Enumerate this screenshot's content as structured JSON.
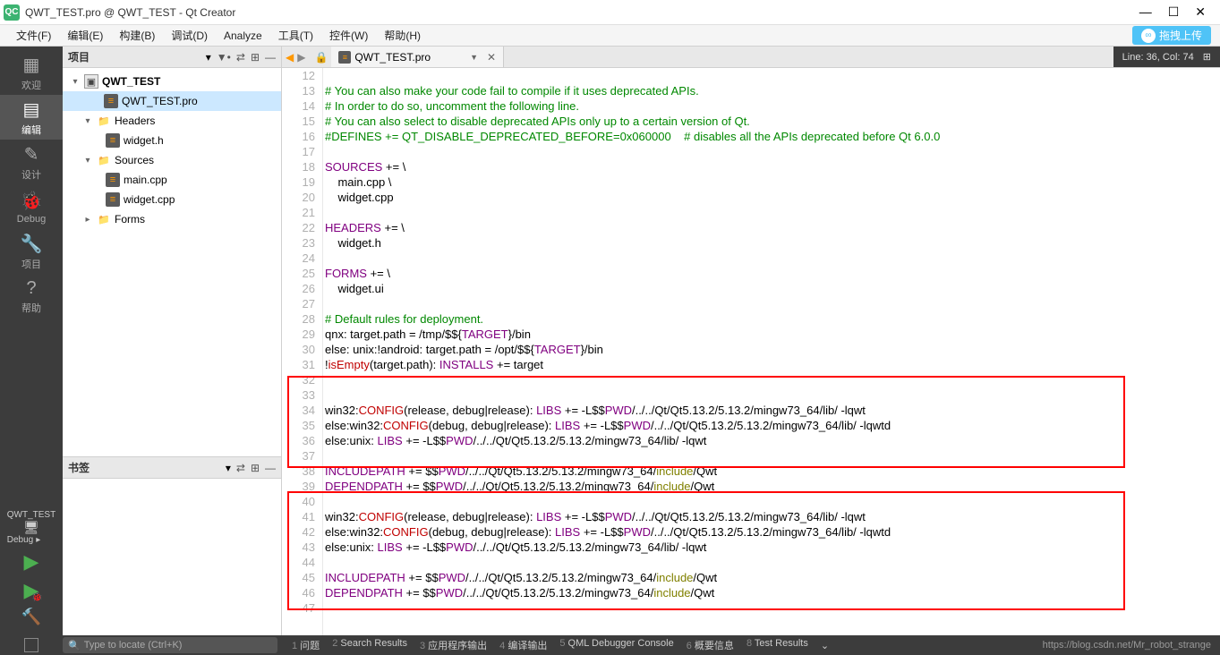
{
  "window": {
    "title": "QWT_TEST.pro @ QWT_TEST - Qt Creator"
  },
  "menu": {
    "file": "文件(F)",
    "edit": "编辑(E)",
    "build": "构建(B)",
    "debug": "调试(D)",
    "analyze": "Analyze",
    "tools": "工具(T)",
    "widgets": "控件(W)",
    "help": "帮助(H)",
    "cloud_upload": "拖拽上传"
  },
  "left_nav": {
    "welcome": "欢迎",
    "edit": "编辑",
    "design": "设计",
    "debug": "Debug",
    "projects": "项目",
    "help": "帮助",
    "kit_name": "QWT_TEST",
    "debug_sel": "Debug"
  },
  "panel": {
    "project_title": "项目",
    "bookmarks_title": "书签"
  },
  "tree": {
    "root": "QWT_TEST",
    "pro_file": "QWT_TEST.pro",
    "headers": "Headers",
    "widget_h": "widget.h",
    "sources": "Sources",
    "main_cpp": "main.cpp",
    "widget_cpp": "widget.cpp",
    "forms": "Forms"
  },
  "tab": {
    "filename": "QWT_TEST.pro"
  },
  "status": {
    "cursor": "Line: 36, Col: 74"
  },
  "code": {
    "lines": [
      {
        "n": 12,
        "t": ""
      },
      {
        "n": 13,
        "t": "# You can also make your code fail to compile if it uses deprecated APIs.",
        "cls": "c-comment"
      },
      {
        "n": 14,
        "t": "# In order to do so, uncomment the following line.",
        "cls": "c-comment"
      },
      {
        "n": 15,
        "t": "# You can also select to disable deprecated APIs only up to a certain version of Qt.",
        "cls": "c-comment"
      },
      {
        "n": 16,
        "t": "#DEFINES += QT_DISABLE_DEPRECATED_BEFORE=0x060000    # disables all the APIs deprecated before Qt 6.0.0",
        "cls": "c-comment"
      },
      {
        "n": 17,
        "t": ""
      },
      {
        "n": 18,
        "segs": [
          {
            "t": "SOURCES",
            "c": "c-purple"
          },
          {
            "t": " += \\"
          }
        ]
      },
      {
        "n": 19,
        "t": "    main.cpp \\"
      },
      {
        "n": 20,
        "t": "    widget.cpp"
      },
      {
        "n": 21,
        "t": ""
      },
      {
        "n": 22,
        "segs": [
          {
            "t": "HEADERS",
            "c": "c-purple"
          },
          {
            "t": " += \\"
          }
        ]
      },
      {
        "n": 23,
        "t": "    widget.h"
      },
      {
        "n": 24,
        "t": ""
      },
      {
        "n": 25,
        "segs": [
          {
            "t": "FORMS",
            "c": "c-purple"
          },
          {
            "t": " += \\"
          }
        ]
      },
      {
        "n": 26,
        "t": "    widget.ui"
      },
      {
        "n": 27,
        "t": ""
      },
      {
        "n": 28,
        "t": "# Default rules for deployment.",
        "cls": "c-comment"
      },
      {
        "n": 29,
        "segs": [
          {
            "t": "qnx: target.path = /tmp/$${"
          },
          {
            "t": "TARGET",
            "c": "c-purple"
          },
          {
            "t": "}/bin"
          }
        ]
      },
      {
        "n": 30,
        "segs": [
          {
            "t": "else: unix:!android: target.path = /opt/$${"
          },
          {
            "t": "TARGET",
            "c": "c-purple"
          },
          {
            "t": "}/bin"
          }
        ]
      },
      {
        "n": 31,
        "segs": [
          {
            "t": "!"
          },
          {
            "t": "isEmpty",
            "c": "c-red"
          },
          {
            "t": "(target.path): "
          },
          {
            "t": "INSTALLS",
            "c": "c-purple"
          },
          {
            "t": " += target"
          }
        ]
      },
      {
        "n": 32,
        "t": ""
      },
      {
        "n": 33,
        "t": ""
      },
      {
        "n": 34,
        "segs": [
          {
            "t": "win32:"
          },
          {
            "t": "CONFIG",
            "c": "c-red"
          },
          {
            "t": "(release, debug|release): "
          },
          {
            "t": "LIBS",
            "c": "c-purple"
          },
          {
            "t": " += -L$$"
          },
          {
            "t": "PWD",
            "c": "c-purple"
          },
          {
            "t": "/../../Qt/Qt5.13.2/5.13.2/mingw73_64/lib/ -lqwt"
          }
        ]
      },
      {
        "n": 35,
        "segs": [
          {
            "t": "else:win32:"
          },
          {
            "t": "CONFIG",
            "c": "c-red"
          },
          {
            "t": "(debug, debug|release): "
          },
          {
            "t": "LIBS",
            "c": "c-purple"
          },
          {
            "t": " += -L$$"
          },
          {
            "t": "PWD",
            "c": "c-purple"
          },
          {
            "t": "/../../Qt/Qt5.13.2/5.13.2/mingw73_64/lib/ -lqwtd"
          }
        ]
      },
      {
        "n": 36,
        "segs": [
          {
            "t": "else:unix: "
          },
          {
            "t": "LIBS",
            "c": "c-purple"
          },
          {
            "t": " += -L$$"
          },
          {
            "t": "PWD",
            "c": "c-purple"
          },
          {
            "t": "/../../Qt/Qt5.13.2/5.13.2/mingw73_64/lib/ -lqwt"
          }
        ]
      },
      {
        "n": 37,
        "t": ""
      },
      {
        "n": 38,
        "segs": [
          {
            "t": "INCLUDEPATH",
            "c": "c-purple"
          },
          {
            "t": " += $$"
          },
          {
            "t": "PWD",
            "c": "c-purple"
          },
          {
            "t": "/../../Qt/Qt5.13.2/5.13.2/mingw73_64/"
          },
          {
            "t": "include",
            "c": "c-olive"
          },
          {
            "t": "/Qwt"
          }
        ]
      },
      {
        "n": 39,
        "segs": [
          {
            "t": "DEPENDPATH",
            "c": "c-purple"
          },
          {
            "t": " += $$"
          },
          {
            "t": "PWD",
            "c": "c-purple"
          },
          {
            "t": "/../../Qt/Qt5.13.2/5.13.2/mingw73_64/"
          },
          {
            "t": "include",
            "c": "c-olive"
          },
          {
            "t": "/Qwt"
          }
        ]
      },
      {
        "n": 40,
        "t": ""
      },
      {
        "n": 41,
        "segs": [
          {
            "t": "win32:"
          },
          {
            "t": "CONFIG",
            "c": "c-red"
          },
          {
            "t": "(release, debug|release): "
          },
          {
            "t": "LIBS",
            "c": "c-purple"
          },
          {
            "t": " += -L$$"
          },
          {
            "t": "PWD",
            "c": "c-purple"
          },
          {
            "t": "/../../Qt/Qt5.13.2/5.13.2/mingw73_64/lib/ -lqwt"
          }
        ]
      },
      {
        "n": 42,
        "segs": [
          {
            "t": "else:win32:"
          },
          {
            "t": "CONFIG",
            "c": "c-red"
          },
          {
            "t": "(debug, debug|release): "
          },
          {
            "t": "LIBS",
            "c": "c-purple"
          },
          {
            "t": " += -L$$"
          },
          {
            "t": "PWD",
            "c": "c-purple"
          },
          {
            "t": "/../../Qt/Qt5.13.2/5.13.2/mingw73_64/lib/ -lqwtd"
          }
        ]
      },
      {
        "n": 43,
        "segs": [
          {
            "t": "else:unix: "
          },
          {
            "t": "LIBS",
            "c": "c-purple"
          },
          {
            "t": " += -L$$"
          },
          {
            "t": "PWD",
            "c": "c-purple"
          },
          {
            "t": "/../../Qt/Qt5.13.2/5.13.2/mingw73_64/lib/ -lqwt"
          }
        ]
      },
      {
        "n": 44,
        "t": ""
      },
      {
        "n": 45,
        "segs": [
          {
            "t": "INCLUDEPATH",
            "c": "c-purple"
          },
          {
            "t": " += $$"
          },
          {
            "t": "PWD",
            "c": "c-purple"
          },
          {
            "t": "/../../Qt/Qt5.13.2/5.13.2/mingw73_64/"
          },
          {
            "t": "include",
            "c": "c-olive"
          },
          {
            "t": "/Qwt"
          }
        ]
      },
      {
        "n": 46,
        "segs": [
          {
            "t": "DEPENDPATH",
            "c": "c-purple"
          },
          {
            "t": " += $$"
          },
          {
            "t": "PWD",
            "c": "c-purple"
          },
          {
            "t": "/../../Qt/Qt5.13.2/5.13.2/mingw73_64/"
          },
          {
            "t": "include",
            "c": "c-olive"
          },
          {
            "t": "/Qwt"
          }
        ]
      },
      {
        "n": 47,
        "t": ""
      }
    ]
  },
  "statusbar": {
    "search_placeholder": "Type to locate (Ctrl+K)",
    "outputs": [
      {
        "n": "1",
        "label": "问题"
      },
      {
        "n": "2",
        "label": "Search Results"
      },
      {
        "n": "3",
        "label": "应用程序输出"
      },
      {
        "n": "4",
        "label": "编译输出"
      },
      {
        "n": "5",
        "label": "QML Debugger Console"
      },
      {
        "n": "6",
        "label": "概要信息"
      },
      {
        "n": "8",
        "label": "Test Results"
      }
    ],
    "watermark": "https://blog.csdn.net/Mr_robot_strange"
  }
}
